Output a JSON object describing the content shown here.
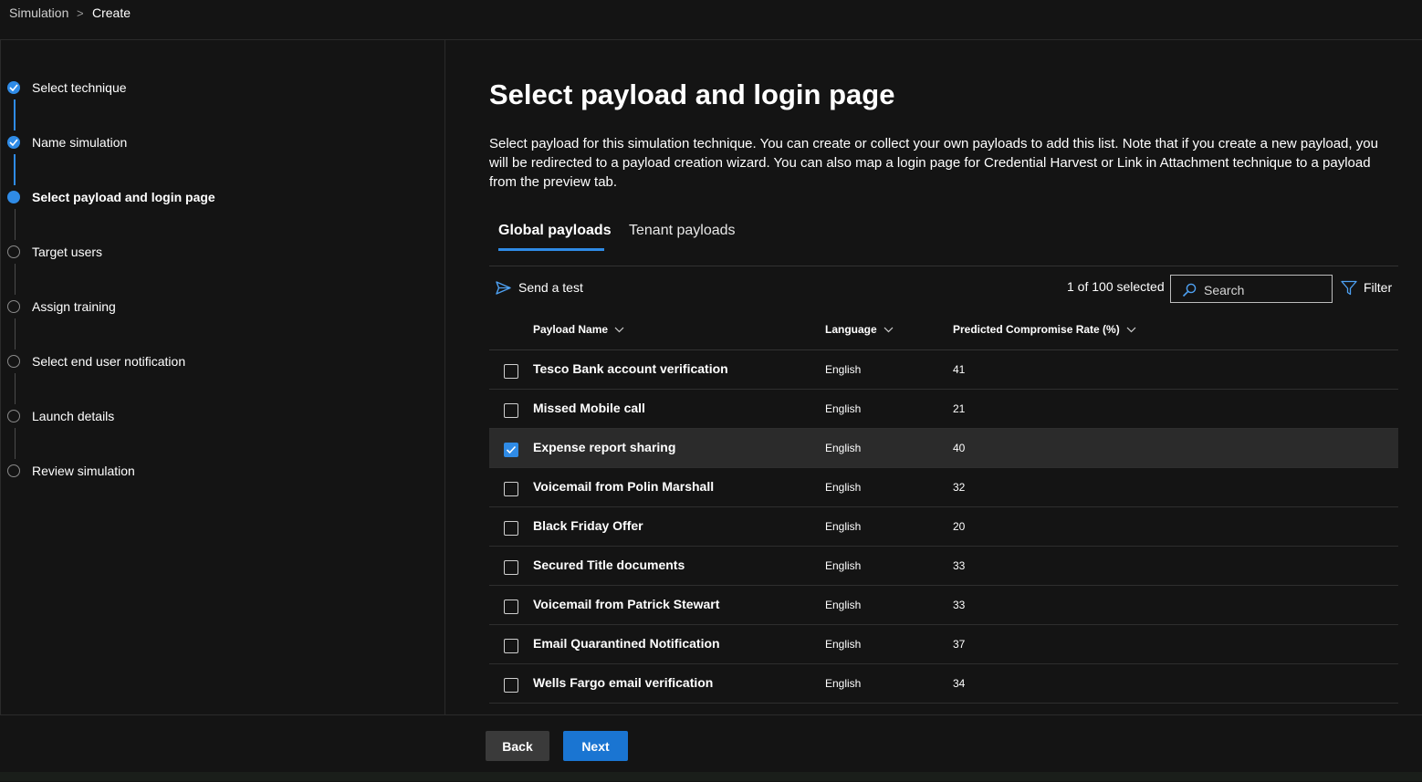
{
  "breadcrumb": {
    "parent": "Simulation",
    "separator": ">",
    "current": "Create"
  },
  "steps": [
    {
      "label": "Select technique",
      "state": "done"
    },
    {
      "label": "Name simulation",
      "state": "done"
    },
    {
      "label": "Select payload and login page",
      "state": "current"
    },
    {
      "label": "Target users",
      "state": "todo"
    },
    {
      "label": "Assign training",
      "state": "todo"
    },
    {
      "label": "Select end user notification",
      "state": "todo"
    },
    {
      "label": "Launch details",
      "state": "todo"
    },
    {
      "label": "Review simulation",
      "state": "todo"
    }
  ],
  "main": {
    "title": "Select payload and login page",
    "description": "Select payload for this simulation technique. You can create or collect your own payloads to add this list. Note that if you create a new payload, you will be redirected to a payload creation wizard. You can also map a login page for Credential Harvest or Link in Attachment technique to a payload from the preview tab.",
    "tabs": [
      {
        "label": "Global payloads",
        "active": true
      },
      {
        "label": "Tenant payloads",
        "active": false
      }
    ]
  },
  "toolbar": {
    "send_test_label": "Send a test",
    "selection_count": "1 of 100 selected",
    "search_placeholder": "Search",
    "search_value": "",
    "filter_label": "Filter"
  },
  "table": {
    "columns": [
      "Payload Name",
      "Language",
      "Predicted Compromise Rate (%)"
    ],
    "rows": [
      {
        "name": "Tesco Bank account verification",
        "language": "English",
        "rate": "41",
        "selected": false
      },
      {
        "name": "Missed Mobile call",
        "language": "English",
        "rate": "21",
        "selected": false
      },
      {
        "name": "Expense report sharing",
        "language": "English",
        "rate": "40",
        "selected": true
      },
      {
        "name": "Voicemail from Polin Marshall",
        "language": "English",
        "rate": "32",
        "selected": false
      },
      {
        "name": "Black Friday Offer",
        "language": "English",
        "rate": "20",
        "selected": false
      },
      {
        "name": "Secured Title documents",
        "language": "English",
        "rate": "33",
        "selected": false
      },
      {
        "name": "Voicemail from Patrick Stewart",
        "language": "English",
        "rate": "33",
        "selected": false
      },
      {
        "name": "Email Quarantined Notification",
        "language": "English",
        "rate": "37",
        "selected": false
      },
      {
        "name": "Wells Fargo email verification",
        "language": "English",
        "rate": "34",
        "selected": false
      }
    ]
  },
  "footer": {
    "back_label": "Back",
    "next_label": "Next"
  },
  "colors": {
    "accent": "#2f8be6",
    "primary_button": "#1a75d2",
    "background": "#141414",
    "selected_row": "#2b2b2b"
  },
  "icons": {
    "send": "send-icon",
    "search": "search-icon",
    "filter": "filter-icon",
    "sort": "chevron-down-icon",
    "check": "check-icon"
  }
}
